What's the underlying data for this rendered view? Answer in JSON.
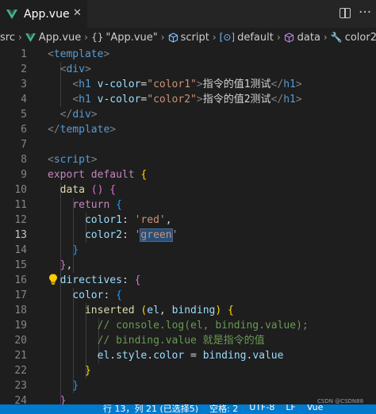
{
  "tab": {
    "label": "App.vue",
    "close_glyph": "✕"
  },
  "editor_actions": {
    "more_glyph": "···"
  },
  "breadcrumb": {
    "items": [
      {
        "label": "src"
      },
      {
        "label": "App.vue"
      },
      {
        "label": "\"App.vue\""
      },
      {
        "label": "script"
      },
      {
        "label": "default"
      },
      {
        "label": "data"
      },
      {
        "label": "color2"
      }
    ],
    "separator": "›"
  },
  "code": {
    "line_numbers": [
      "1",
      "2",
      "3",
      "4",
      "5",
      "6",
      "7",
      "8",
      "9",
      "10",
      "11",
      "12",
      "13",
      "14",
      "15",
      "16",
      "17",
      "18",
      "19",
      "20",
      "21",
      "22",
      "23",
      "24"
    ],
    "active_line": "13",
    "lines": [
      {
        "tokens": [
          {
            "t": "<",
            "c": "t-punct"
          },
          {
            "t": "template",
            "c": "t-tag"
          },
          {
            "t": ">",
            "c": "t-punct"
          }
        ]
      },
      {
        "tokens": [
          {
            "t": "  "
          },
          {
            "t": "<",
            "c": "t-punct"
          },
          {
            "t": "div",
            "c": "t-tag"
          },
          {
            "t": ">",
            "c": "t-punct"
          }
        ]
      },
      {
        "tokens": [
          {
            "t": "    "
          },
          {
            "t": "<",
            "c": "t-punct"
          },
          {
            "t": "h1",
            "c": "t-tag"
          },
          {
            "t": " "
          },
          {
            "t": "v-color",
            "c": "t-attr"
          },
          {
            "t": "=",
            "c": "t-text"
          },
          {
            "t": "\"color1\"",
            "c": "t-str"
          },
          {
            "t": ">",
            "c": "t-punct"
          },
          {
            "t": "指令的值1测试",
            "c": "t-text"
          },
          {
            "t": "</",
            "c": "t-punct"
          },
          {
            "t": "h1",
            "c": "t-tag"
          },
          {
            "t": ">",
            "c": "t-punct"
          }
        ]
      },
      {
        "tokens": [
          {
            "t": "    "
          },
          {
            "t": "<",
            "c": "t-punct"
          },
          {
            "t": "h1",
            "c": "t-tag"
          },
          {
            "t": " "
          },
          {
            "t": "v-color",
            "c": "t-attr"
          },
          {
            "t": "=",
            "c": "t-text"
          },
          {
            "t": "\"color2\"",
            "c": "t-str"
          },
          {
            "t": ">",
            "c": "t-punct"
          },
          {
            "t": "指令的值2测试",
            "c": "t-text"
          },
          {
            "t": "</",
            "c": "t-punct"
          },
          {
            "t": "h1",
            "c": "t-tag"
          },
          {
            "t": ">",
            "c": "t-punct"
          }
        ]
      },
      {
        "tokens": [
          {
            "t": "  "
          },
          {
            "t": "</",
            "c": "t-punct"
          },
          {
            "t": "div",
            "c": "t-tag"
          },
          {
            "t": ">",
            "c": "t-punct"
          }
        ]
      },
      {
        "tokens": [
          {
            "t": "</",
            "c": "t-punct"
          },
          {
            "t": "template",
            "c": "t-tag"
          },
          {
            "t": ">",
            "c": "t-punct"
          }
        ]
      },
      {
        "tokens": []
      },
      {
        "tokens": [
          {
            "t": "<",
            "c": "t-punct"
          },
          {
            "t": "script",
            "c": "t-tag"
          },
          {
            "t": ">",
            "c": "t-punct"
          }
        ]
      },
      {
        "tokens": [
          {
            "t": "export",
            "c": "t-kw"
          },
          {
            "t": " "
          },
          {
            "t": "default",
            "c": "t-kw"
          },
          {
            "t": " "
          },
          {
            "t": "{",
            "c": "t-br1"
          }
        ]
      },
      {
        "tokens": [
          {
            "t": "  "
          },
          {
            "t": "data",
            "c": "t-fn"
          },
          {
            "t": " "
          },
          {
            "t": "()",
            "c": "t-br2"
          },
          {
            "t": " "
          },
          {
            "t": "{",
            "c": "t-br2"
          }
        ]
      },
      {
        "tokens": [
          {
            "t": "    "
          },
          {
            "t": "return",
            "c": "t-kw"
          },
          {
            "t": " "
          },
          {
            "t": "{",
            "c": "t-br3"
          }
        ]
      },
      {
        "tokens": [
          {
            "t": "      "
          },
          {
            "t": "color1",
            "c": "t-var"
          },
          {
            "t": ": ",
            "c": "t-text"
          },
          {
            "t": "'red'",
            "c": "t-str"
          },
          {
            "t": ",",
            "c": "t-text"
          }
        ]
      },
      {
        "tokens": [
          {
            "t": "      "
          },
          {
            "t": "color2",
            "c": "t-var"
          },
          {
            "t": ": ",
            "c": "t-text"
          },
          {
            "t": "'",
            "c": "t-str"
          },
          {
            "t": "green",
            "c": "t-str",
            "sel": true
          },
          {
            "t": "'",
            "c": "t-str"
          }
        ]
      },
      {
        "tokens": [
          {
            "t": "    "
          },
          {
            "t": "}",
            "c": "t-br3"
          }
        ]
      },
      {
        "tokens": [
          {
            "t": "  "
          },
          {
            "t": "}",
            "c": "t-br2"
          },
          {
            "t": ",",
            "c": "t-text"
          }
        ]
      },
      {
        "tokens": [
          {
            "t": "  "
          },
          {
            "t": "directives",
            "c": "t-var"
          },
          {
            "t": ": ",
            "c": "t-text"
          },
          {
            "t": "{",
            "c": "t-br2"
          }
        ]
      },
      {
        "tokens": [
          {
            "t": "    "
          },
          {
            "t": "color",
            "c": "t-var"
          },
          {
            "t": ": ",
            "c": "t-text"
          },
          {
            "t": "{",
            "c": "t-br3"
          }
        ]
      },
      {
        "tokens": [
          {
            "t": "      "
          },
          {
            "t": "inserted",
            "c": "t-fn"
          },
          {
            "t": " "
          },
          {
            "t": "(",
            "c": "t-br1"
          },
          {
            "t": "el",
            "c": "t-var"
          },
          {
            "t": ", ",
            "c": "t-text"
          },
          {
            "t": "binding",
            "c": "t-var"
          },
          {
            "t": ")",
            "c": "t-br1"
          },
          {
            "t": " "
          },
          {
            "t": "{",
            "c": "t-br1"
          }
        ]
      },
      {
        "tokens": [
          {
            "t": "        "
          },
          {
            "t": "// console.log(el, binding.value);",
            "c": "t-cmt"
          }
        ]
      },
      {
        "tokens": [
          {
            "t": "        "
          },
          {
            "t": "// binding.value 就是指令的值",
            "c": "t-cmt"
          }
        ]
      },
      {
        "tokens": [
          {
            "t": "        "
          },
          {
            "t": "el",
            "c": "t-var"
          },
          {
            "t": ".",
            "c": "t-text"
          },
          {
            "t": "style",
            "c": "t-var"
          },
          {
            "t": ".",
            "c": "t-text"
          },
          {
            "t": "color",
            "c": "t-var"
          },
          {
            "t": " = ",
            "c": "t-op"
          },
          {
            "t": "binding",
            "c": "t-var"
          },
          {
            "t": ".",
            "c": "t-text"
          },
          {
            "t": "value",
            "c": "t-var"
          }
        ]
      },
      {
        "tokens": [
          {
            "t": "      "
          },
          {
            "t": "}",
            "c": "t-br1"
          }
        ]
      },
      {
        "tokens": [
          {
            "t": "    "
          },
          {
            "t": "}",
            "c": "t-br3"
          }
        ]
      },
      {
        "tokens": [
          {
            "t": "  "
          },
          {
            "t": "}",
            "c": "t-br2"
          }
        ]
      }
    ]
  },
  "statusbar": {
    "items": [
      "行 13，列 21 (已选择5)",
      "空格: 2",
      "UTF-8",
      "LF",
      "Vue"
    ]
  },
  "watermark": "CSDN @CSDN88",
  "colors": {
    "background": "#1e1e1e",
    "tab_inactive": "#252526",
    "statusbar": "#007acc",
    "vue_logo_green": "#41b883",
    "vue_logo_dark": "#35495e"
  },
  "icons": [
    "vue-logo-icon",
    "close-icon",
    "split-editor-icon",
    "more-actions-icon",
    "braces-icon",
    "cube-icon",
    "field-icon",
    "wrench-icon",
    "lightbulb-icon"
  ]
}
